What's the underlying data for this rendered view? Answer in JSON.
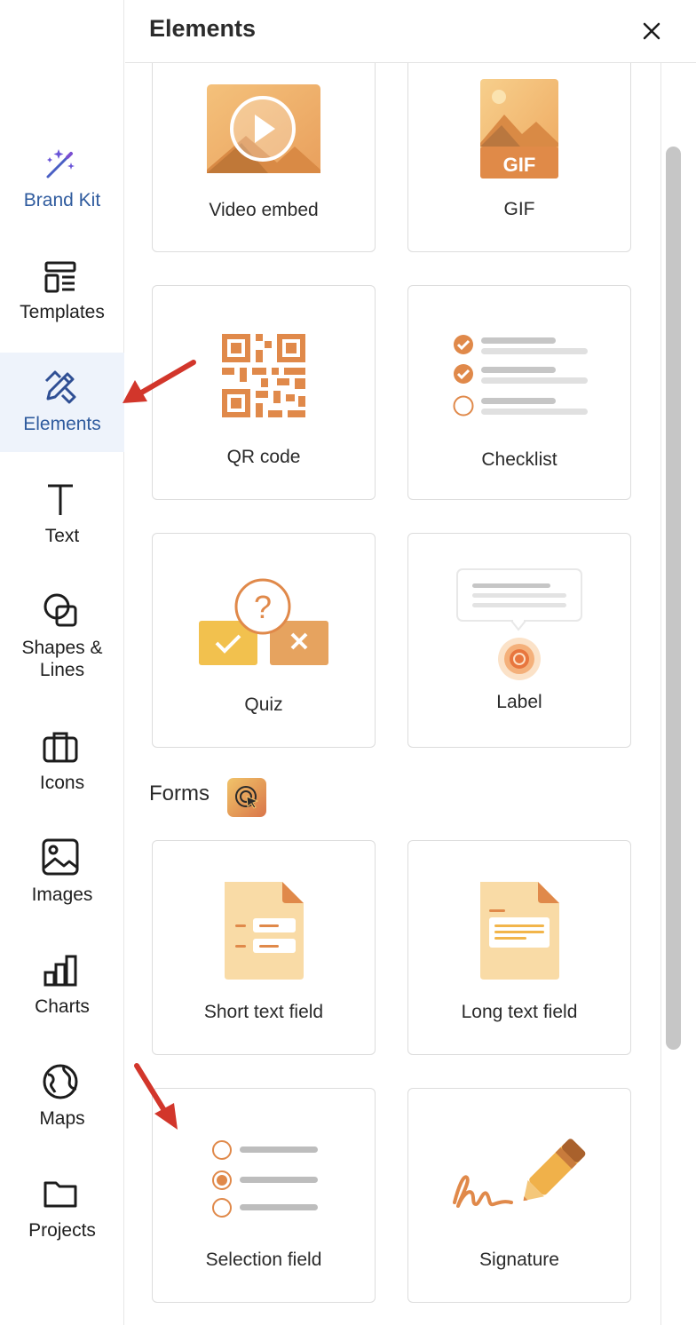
{
  "rail": {
    "items": [
      {
        "label": "Brand Kit",
        "icon": "magic-wand-icon"
      },
      {
        "label": "Templates",
        "icon": "templates-icon"
      },
      {
        "label": "Elements",
        "icon": "elements-icon",
        "active": true
      },
      {
        "label": "Text",
        "icon": "text-icon"
      },
      {
        "label": "Shapes &",
        "label2": "Lines",
        "icon": "shapes-icon"
      },
      {
        "label": "Icons",
        "icon": "briefcase-icon"
      },
      {
        "label": "Images",
        "icon": "image-icon"
      },
      {
        "label": "Charts",
        "icon": "bar-chart-icon"
      },
      {
        "label": "Maps",
        "icon": "globe-icon"
      },
      {
        "label": "Projects",
        "icon": "folder-icon"
      }
    ]
  },
  "panel": {
    "title": "Elements",
    "cards": [
      {
        "label": "Video embed"
      },
      {
        "label": "GIF",
        "badge": "GIF"
      },
      {
        "label": "QR code"
      },
      {
        "label": "Checklist"
      },
      {
        "label": "Quiz"
      },
      {
        "label": "Label"
      }
    ],
    "forms_section": {
      "title": "Forms",
      "cards": [
        {
          "label": "Short text field"
        },
        {
          "label": "Long text field"
        },
        {
          "label": "Selection field"
        },
        {
          "label": "Signature"
        }
      ]
    }
  },
  "colors": {
    "accent_orange": "#e0894a",
    "accent_light": "#f8d9a6",
    "active_bg": "#eef3fb",
    "active_text": "#2f5b9e",
    "arrow_red": "#d2362b"
  }
}
